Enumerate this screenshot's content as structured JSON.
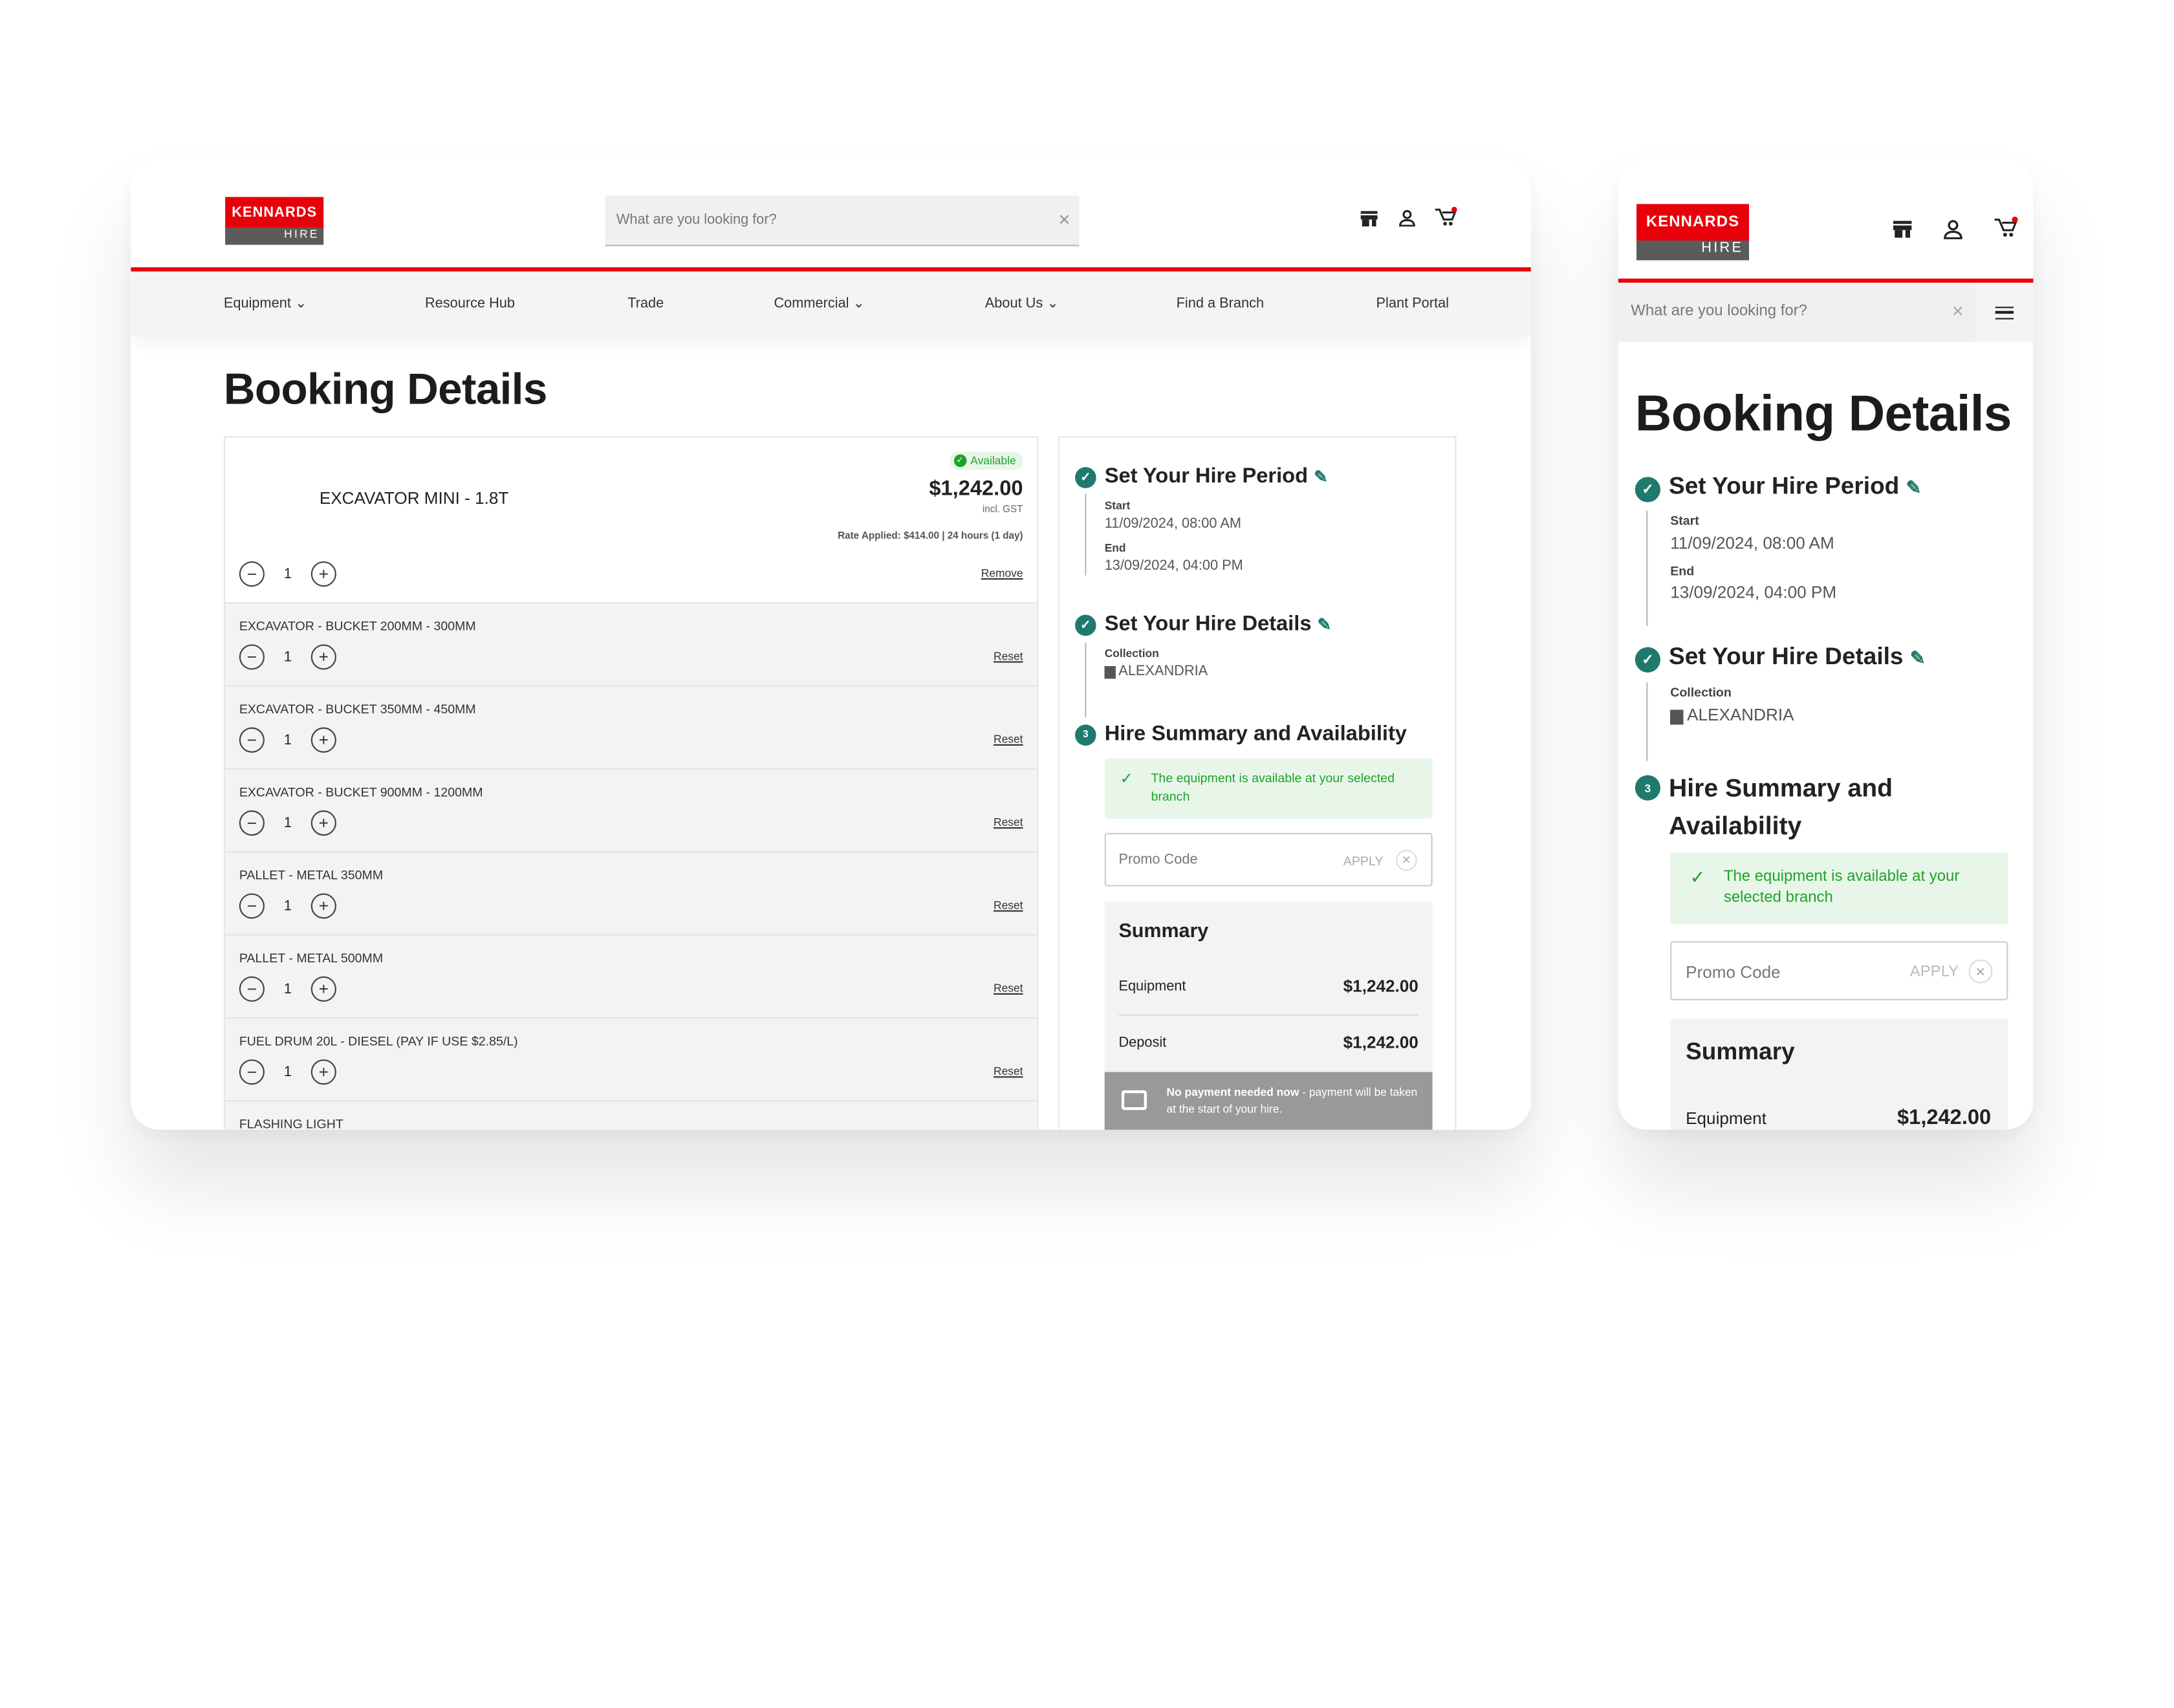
{
  "brand": {
    "logo_top": "KENNARDS",
    "logo_bottom": "HIRE",
    "accent": "#e8000b",
    "teal": "#1f7a6d"
  },
  "search": {
    "placeholder": "What are you looking for?"
  },
  "nav": [
    {
      "label": "Equipment",
      "dropdown": true
    },
    {
      "label": "Resource Hub"
    },
    {
      "label": "Trade"
    },
    {
      "label": "Commercial",
      "dropdown": true
    },
    {
      "label": "About Us",
      "dropdown": true
    },
    {
      "label": "Find a Branch"
    },
    {
      "label": "Plant Portal"
    }
  ],
  "page_title": "Booking Details",
  "main_item": {
    "name": "EXCAVATOR MINI - 1.8T",
    "badge": "Available",
    "price": "$1,242.00",
    "tax_note": "incl. GST",
    "rate": "Rate Applied: $414.00 | 24 hours (1 day)",
    "qty": "1",
    "remove": "Remove"
  },
  "addons": [
    {
      "name": "EXCAVATOR - BUCKET 200MM - 300MM",
      "qty": "1",
      "action": "Reset"
    },
    {
      "name": "EXCAVATOR - BUCKET 350MM - 450MM",
      "qty": "1",
      "action": "Reset"
    },
    {
      "name": "EXCAVATOR - BUCKET 900MM - 1200MM",
      "qty": "1",
      "action": "Reset"
    },
    {
      "name": "PALLET - METAL 350MM",
      "qty": "1",
      "action": "Reset"
    },
    {
      "name": "PALLET - METAL 500MM",
      "qty": "1",
      "action": "Reset"
    },
    {
      "name": "FUEL DRUM 20L - DIESEL (PAY IF USE $2.85/L)",
      "qty": "1",
      "action": "Reset"
    },
    {
      "name": "FLASHING LIGHT"
    }
  ],
  "steps": {
    "period": {
      "title": "Set Your Hire Period",
      "start_label": "Start",
      "start": "11/09/2024, 08:00 AM",
      "end_label": "End",
      "end": "13/09/2024, 04:00 PM"
    },
    "details": {
      "title": "Set Your Hire Details",
      "collection_label": "Collection",
      "branch": "ALEXANDRIA"
    },
    "summary": {
      "number": "3",
      "title": "Hire Summary and Availability",
      "availability": "The equipment is available at your selected branch"
    }
  },
  "promo": {
    "placeholder": "Promo Code",
    "apply": "APPLY"
  },
  "summary": {
    "title": "Summary",
    "equipment_label": "Equipment",
    "equipment": "$1,242.00",
    "deposit_label": "Deposit",
    "deposit": "$1,242.00",
    "note_bold": "No payment needed now",
    "note": " - payment will be taken at the start of your hire."
  }
}
